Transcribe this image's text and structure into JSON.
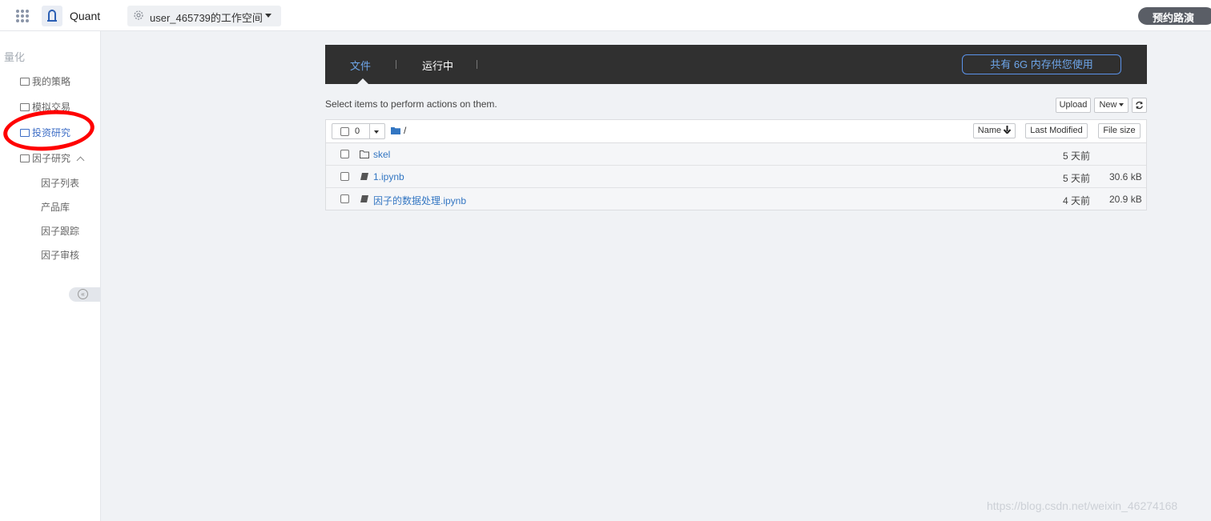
{
  "topbar": {
    "app_name": "Quant",
    "workspace": "user_465739的工作空间",
    "roadshow_button": "预约路演"
  },
  "sidebar": {
    "section": "量化",
    "items": [
      {
        "label": "我的策略",
        "icon": "strategy-icon"
      },
      {
        "label": "模拟交易",
        "icon": "trade-icon"
      },
      {
        "label": "投资研究",
        "icon": "research-icon",
        "active": true
      },
      {
        "label": "因子研究",
        "icon": "factor-icon",
        "expanded": true
      }
    ],
    "sub_items": [
      "因子列表",
      "产品库",
      "因子跟踪",
      "因子审核"
    ]
  },
  "notebook": {
    "tabs": [
      "文件",
      "运行中"
    ],
    "memory_button": "共有 6G 内存供您使用",
    "toolbar_hint": "Select items to perform actions on them.",
    "upload_label": "Upload",
    "new_label": "New",
    "selected_count": "0",
    "path": "/",
    "columns": {
      "name": "Name",
      "modified": "Last Modified",
      "size": "File size"
    },
    "files": [
      {
        "name": "skel",
        "type": "folder",
        "modified": "5 天前",
        "size": ""
      },
      {
        "name": "1.ipynb",
        "type": "notebook",
        "modified": "5 天前",
        "size": "30.6 kB"
      },
      {
        "name": "因子的数据处理.ipynb",
        "type": "notebook",
        "modified": "4 天前",
        "size": "20.9 kB"
      }
    ]
  },
  "watermark": "https://blog.csdn.net/weixin_46274168",
  "colors": {
    "accent": "#3e6ec6",
    "header_bg": "#303030",
    "annotation": "#ff0000"
  }
}
